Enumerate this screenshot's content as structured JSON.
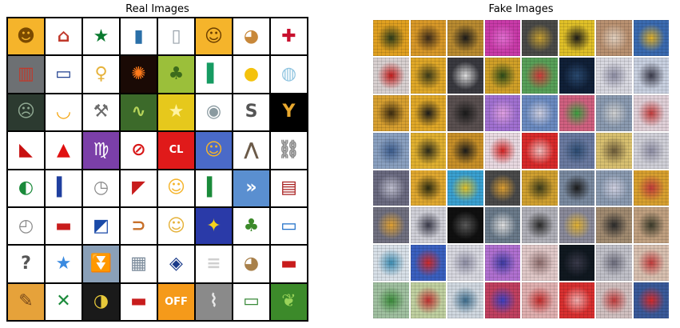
{
  "titles": {
    "left": "Real Images",
    "right": "Fake Images"
  },
  "real_tiles": [
    {
      "icon": "baby-face-icon",
      "bg": "#f5b42b",
      "fg": "#7a4a00",
      "glyph": "☻"
    },
    {
      "icon": "house-icon",
      "bg": "#ffffff",
      "fg": "#c0392b",
      "glyph": "⌂"
    },
    {
      "icon": "ghana-flag-icon",
      "bg": "#ffffff",
      "fg": "#0a7a2f",
      "glyph": "★"
    },
    {
      "icon": "thread-spool-icon",
      "bg": "#ffffff",
      "fg": "#2a6fa8",
      "glyph": "▮"
    },
    {
      "icon": "salt-shaker-icon",
      "bg": "#ffffff",
      "fg": "#9aa3ab",
      "glyph": "▯"
    },
    {
      "icon": "woman-face-icon",
      "bg": "#f5b42b",
      "fg": "#6b3f00",
      "glyph": "☺"
    },
    {
      "icon": "dog-face-icon",
      "bg": "#ffffff",
      "fg": "#c8883a",
      "glyph": "◕"
    },
    {
      "icon": "norway-flag-icon",
      "bg": "#ffffff",
      "fg": "#c8102e",
      "glyph": "✚"
    },
    {
      "icon": "barber-pole-icon",
      "bg": "#6d7073",
      "fg": "#c0392b",
      "glyph": "▥"
    },
    {
      "icon": "police-car-icon",
      "bg": "#ffffff",
      "fg": "#1f3f8f",
      "glyph": "▭"
    },
    {
      "icon": "woman-icon",
      "bg": "#ffffff",
      "fg": "#e6b23a",
      "glyph": "♀"
    },
    {
      "icon": "fireworks-icon",
      "bg": "#1a0a05",
      "fg": "#ff7a1a",
      "glyph": "✺"
    },
    {
      "icon": "palm-tree-icon",
      "bg": "#9bbf3a",
      "fg": "#3d6b1c",
      "glyph": "♣"
    },
    {
      "icon": "ireland-flag-icon",
      "bg": "#ffffff",
      "fg": "#169b62",
      "glyph": "▌"
    },
    {
      "icon": "full-moon-icon",
      "bg": "#ffffff",
      "fg": "#f4c20d",
      "glyph": "●"
    },
    {
      "icon": "snow-globe-icon",
      "bg": "#ffffff",
      "fg": "#8fc4e0",
      "glyph": "◍"
    },
    {
      "icon": "zombie-icon",
      "bg": "#2c3a30",
      "fg": "#8fa892",
      "glyph": "☹"
    },
    {
      "icon": "upside-down-face-icon",
      "bg": "#ffffff",
      "fg": "#f5a30a",
      "glyph": "◡"
    },
    {
      "icon": "hammer-wrench-icon",
      "bg": "#ffffff",
      "fg": "#6b6b6b",
      "glyph": "⚒"
    },
    {
      "icon": "dragon-icon",
      "bg": "#3c6a2a",
      "fg": "#b6d45a",
      "glyph": "∿"
    },
    {
      "icon": "shooting-star-icon",
      "bg": "#e6c81c",
      "fg": "#fff3a0",
      "glyph": "★"
    },
    {
      "icon": "alien-icon",
      "bg": "#ffffff",
      "fg": "#8a9aa0",
      "glyph": "◉"
    },
    {
      "icon": "dollar-sign-icon",
      "bg": "#ffffff",
      "fg": "#555555",
      "glyph": "S"
    },
    {
      "icon": "gymnast-icon",
      "bg": "#000000",
      "fg": "#e8a82e",
      "glyph": "Y"
    },
    {
      "icon": "high-heel-icon",
      "bg": "#ffffff",
      "fg": "#c81010",
      "glyph": "◣"
    },
    {
      "icon": "red-triangle-up-icon",
      "bg": "#ffffff",
      "fg": "#e01010",
      "glyph": "▲"
    },
    {
      "icon": "virgo-icon",
      "bg": "#7b3fa8",
      "fg": "#ffffff",
      "glyph": "♍"
    },
    {
      "icon": "prohibited-icon",
      "bg": "#ffffff",
      "fg": "#d81818",
      "glyph": "⊘"
    },
    {
      "icon": "cl-button-icon",
      "bg": "#e01a1a",
      "fg": "#ffffff",
      "glyph": "CL"
    },
    {
      "icon": "family-icon",
      "bg": "#4a6ac8",
      "fg": "#f5b42b",
      "glyph": "☺"
    },
    {
      "icon": "bat-icon",
      "bg": "#ffffff",
      "fg": "#6b5a48",
      "glyph": "⋀"
    },
    {
      "icon": "chains-icon",
      "bg": "#ffffff",
      "fg": "#8a8a8a",
      "glyph": "⛓"
    },
    {
      "icon": "comoros-flag-icon",
      "bg": "#ffffff",
      "fg": "#1a8a3a",
      "glyph": "◐"
    },
    {
      "icon": "france-flag-icon",
      "bg": "#ffffff",
      "fg": "#1f3f9f",
      "glyph": "▍"
    },
    {
      "icon": "stopwatch-icon",
      "bg": "#ffffff",
      "fg": "#8a8a8a",
      "glyph": "◷"
    },
    {
      "icon": "sint-maarten-flag-icon",
      "bg": "#ffffff",
      "fg": "#c81c1c",
      "glyph": "◤"
    },
    {
      "icon": "grinning-face-icon",
      "bg": "#ffffff",
      "fg": "#f5b42b",
      "glyph": "☺"
    },
    {
      "icon": "italy-flag-icon",
      "bg": "#ffffff",
      "fg": "#1a8a3a",
      "glyph": "▍"
    },
    {
      "icon": "fast-forward-button-icon",
      "bg": "#5a8fd0",
      "fg": "#ffffff",
      "glyph": "»"
    },
    {
      "icon": "oil-drum-icon",
      "bg": "#ffffff",
      "fg": "#a82020",
      "glyph": "▤"
    },
    {
      "icon": "clock-icon",
      "bg": "#ffffff",
      "fg": "#8a8a8a",
      "glyph": "◴"
    },
    {
      "icon": "liechtenstein-flag-icon",
      "bg": "#ffffff",
      "fg": "#c81c1c",
      "glyph": "▬"
    },
    {
      "icon": "namibia-flag-icon",
      "bg": "#ffffff",
      "fg": "#1a4aa8",
      "glyph": "◩"
    },
    {
      "icon": "hot-dog-icon",
      "bg": "#ffffff",
      "fg": "#c8702a",
      "glyph": "⊃"
    },
    {
      "icon": "person-turban-icon",
      "bg": "#ffffff",
      "fg": "#e6b23a",
      "glyph": "☺"
    },
    {
      "icon": "reunion-flag-icon",
      "bg": "#2a3aa8",
      "fg": "#f5d21a",
      "glyph": "✦"
    },
    {
      "icon": "broccoli-icon",
      "bg": "#ffffff",
      "fg": "#3c8a2a",
      "glyph": "♣"
    },
    {
      "icon": "trolleybus-icon",
      "bg": "#ffffff",
      "fg": "#1f6fc8",
      "glyph": "▭"
    },
    {
      "icon": "question-mark-button-icon",
      "bg": "#ffffff",
      "fg": "#555555",
      "glyph": "?"
    },
    {
      "icon": "somalia-flag-icon",
      "bg": "#ffffff",
      "fg": "#3a8ae0",
      "glyph": "★"
    },
    {
      "icon": "fast-down-button-icon",
      "bg": "#8aa0b8",
      "fg": "#ffffff",
      "glyph": "⏬"
    },
    {
      "icon": "office-building-icon",
      "bg": "#ffffff",
      "fg": "#7a8a9a",
      "glyph": "▦"
    },
    {
      "icon": "guam-flag-icon",
      "bg": "#ffffff",
      "fg": "#1a3a8a",
      "glyph": "◈"
    },
    {
      "icon": "scroll-icon",
      "bg": "#ffffff",
      "fg": "#cfcfcf",
      "glyph": "≡"
    },
    {
      "icon": "see-no-evil-monkey-icon",
      "bg": "#ffffff",
      "fg": "#a8804a",
      "glyph": "◕"
    },
    {
      "icon": "slovenia-flag-icon",
      "bg": "#ffffff",
      "fg": "#c81c1c",
      "glyph": "▬"
    },
    {
      "icon": "artist-palette-icon",
      "bg": "#e6a23a",
      "fg": "#7a4a1a",
      "glyph": "✎"
    },
    {
      "icon": "jamaica-flag-icon",
      "bg": "#ffffff",
      "fg": "#1a8a3a",
      "glyph": "✕"
    },
    {
      "icon": "crescent-moon-icon",
      "bg": "#1a1a1a",
      "fg": "#e6c83a",
      "glyph": "◑"
    },
    {
      "icon": "toolbox-icon",
      "bg": "#ffffff",
      "fg": "#c81c1c",
      "glyph": "▬"
    },
    {
      "icon": "off-button-icon",
      "bg": "#f59a1a",
      "fg": "#ffffff",
      "glyph": "OFF"
    },
    {
      "icon": "bone-icon",
      "bg": "#8a8a8a",
      "fg": "#e8e8e8",
      "glyph": "⌇"
    },
    {
      "icon": "tram-icon",
      "bg": "#ffffff",
      "fg": "#3a8a3a",
      "glyph": "▭"
    },
    {
      "icon": "leafy-green-icon",
      "bg": "#3c8a2a",
      "fg": "#9ad45a",
      "glyph": "❦"
    }
  ],
  "fake_tiles": [
    {
      "icon": "generated-blur-icon",
      "bg": "#e0a020",
      "fg": "#2a3a1a"
    },
    {
      "icon": "generated-blur-icon",
      "bg": "#d89828",
      "fg": "#3a2a1a"
    },
    {
      "icon": "generated-blur-icon",
      "bg": "#b88a30",
      "fg": "#1a1a1a"
    },
    {
      "icon": "generated-blur-icon",
      "bg": "#c83aa8",
      "fg": "#e070d0"
    },
    {
      "icon": "generated-blur-icon",
      "bg": "#4a4a48",
      "fg": "#c8a030"
    },
    {
      "icon": "generated-blur-icon",
      "bg": "#e0c028",
      "fg": "#1a1a1a"
    },
    {
      "icon": "generated-blur-icon",
      "bg": "#b89070",
      "fg": "#e0d0c0"
    },
    {
      "icon": "generated-blur-icon",
      "bg": "#3a6ab0",
      "fg": "#e0b028"
    },
    {
      "icon": "generated-blur-icon",
      "bg": "#d8d0d0",
      "fg": "#c01a1a"
    },
    {
      "icon": "generated-blur-icon",
      "bg": "#e0a828",
      "fg": "#3a3a1a"
    },
    {
      "icon": "generated-blur-icon",
      "bg": "#3a3a40",
      "fg": "#e0e0e0"
    },
    {
      "icon": "generated-blur-icon",
      "bg": "#d0a028",
      "fg": "#2a4a1a"
    },
    {
      "icon": "generated-blur-icon",
      "bg": "#58a058",
      "fg": "#d03a3a"
    },
    {
      "icon": "generated-blur-icon",
      "bg": "#102038",
      "fg": "#2a4a70"
    },
    {
      "icon": "generated-blur-icon",
      "bg": "#d8d8e0",
      "fg": "#8a8aa0"
    },
    {
      "icon": "generated-blur-icon",
      "bg": "#c8d0e0",
      "fg": "#3a3a4a"
    },
    {
      "icon": "generated-blur-icon",
      "bg": "#d8a030",
      "fg": "#3a2a10"
    },
    {
      "icon": "generated-blur-icon",
      "bg": "#e0a828",
      "fg": "#1a1a1a"
    },
    {
      "icon": "generated-blur-icon",
      "bg": "#5a5050",
      "fg": "#1a1a1a"
    },
    {
      "icon": "generated-blur-icon",
      "bg": "#a070d0",
      "fg": "#e0a0e0"
    },
    {
      "icon": "generated-blur-icon",
      "bg": "#6a8ac0",
      "fg": "#d0d0e0"
    },
    {
      "icon": "generated-blur-icon",
      "bg": "#d06080",
      "fg": "#3aa040"
    },
    {
      "icon": "generated-blur-icon",
      "bg": "#8a9ab0",
      "fg": "#d0d0d0"
    },
    {
      "icon": "generated-blur-icon",
      "bg": "#e0d0d8",
      "fg": "#c03a3a"
    },
    {
      "icon": "generated-blur-icon",
      "bg": "#8aa0c0",
      "fg": "#3a5a8a"
    },
    {
      "icon": "generated-blur-icon",
      "bg": "#e0b030",
      "fg": "#2a2a1a"
    },
    {
      "icon": "generated-blur-icon",
      "bg": "#c89028",
      "fg": "#1a1a1a"
    },
    {
      "icon": "generated-blur-icon",
      "bg": "#e8d8e0",
      "fg": "#d02020"
    },
    {
      "icon": "generated-blur-icon",
      "bg": "#d82a2a",
      "fg": "#f0c0c0"
    },
    {
      "icon": "generated-blur-icon",
      "bg": "#6a7aa0",
      "fg": "#2a4a70"
    },
    {
      "icon": "generated-blur-icon",
      "bg": "#d8c070",
      "fg": "#6a5a3a"
    },
    {
      "icon": "generated-blur-icon",
      "bg": "#d0d0d8",
      "fg": "#8a8aa0"
    },
    {
      "icon": "generated-blur-icon",
      "bg": "#6a6a80",
      "fg": "#c0c0d0"
    },
    {
      "icon": "generated-blur-icon",
      "bg": "#e0a830",
      "fg": "#2a2a10"
    },
    {
      "icon": "generated-blur-icon",
      "bg": "#3aa0d0",
      "fg": "#e0c028"
    },
    {
      "icon": "generated-blur-icon",
      "bg": "#4a4a4a",
      "fg": "#e0a030"
    },
    {
      "icon": "generated-blur-icon",
      "bg": "#d0a030",
      "fg": "#3a3a1a"
    },
    {
      "icon": "generated-blur-icon",
      "bg": "#7a8aa0",
      "fg": "#1a1a1a"
    },
    {
      "icon": "generated-blur-icon",
      "bg": "#8a9ab0",
      "fg": "#d0d0e0"
    },
    {
      "icon": "generated-blur-icon",
      "bg": "#d8a030",
      "fg": "#c03a3a"
    },
    {
      "icon": "generated-blur-icon",
      "bg": "#707080",
      "fg": "#e0a030"
    },
    {
      "icon": "generated-blur-icon",
      "bg": "#d0d0d8",
      "fg": "#3a3a4a"
    },
    {
      "icon": "generated-blur-icon",
      "bg": "#101010",
      "fg": "#5a5a5a"
    },
    {
      "icon": "generated-blur-icon",
      "bg": "#6a7a8a",
      "fg": "#e0e0e0"
    },
    {
      "icon": "generated-blur-icon",
      "bg": "#b0b0b8",
      "fg": "#2a2a2a"
    },
    {
      "icon": "generated-blur-icon",
      "bg": "#8a8a9a",
      "fg": "#e0b030"
    },
    {
      "icon": "generated-blur-icon",
      "bg": "#a08a70",
      "fg": "#2a2a2a"
    },
    {
      "icon": "generated-blur-icon",
      "bg": "#c0a080",
      "fg": "#3a3a2a"
    },
    {
      "icon": "generated-blur-icon",
      "bg": "#d8e0e8",
      "fg": "#3a8ab0"
    },
    {
      "icon": "generated-blur-icon",
      "bg": "#3a60c0",
      "fg": "#d02a2a"
    },
    {
      "icon": "generated-blur-icon",
      "bg": "#d8d8e0",
      "fg": "#8a8aa0"
    },
    {
      "icon": "generated-blur-icon",
      "bg": "#b070d0",
      "fg": "#3a3aa0"
    },
    {
      "icon": "generated-blur-icon",
      "bg": "#e0c8c8",
      "fg": "#8a6a6a"
    },
    {
      "icon": "generated-blur-icon",
      "bg": "#101820",
      "fg": "#3a3a4a"
    },
    {
      "icon": "generated-blur-icon",
      "bg": "#c0c0c8",
      "fg": "#6a6a7a"
    },
    {
      "icon": "generated-blur-icon",
      "bg": "#d8c0b0",
      "fg": "#c03a3a"
    },
    {
      "icon": "generated-blur-icon",
      "bg": "#a0c0a0",
      "fg": "#3a8a3a"
    },
    {
      "icon": "generated-blur-icon",
      "bg": "#c0d0a0",
      "fg": "#c03030"
    },
    {
      "icon": "generated-blur-icon",
      "bg": "#d0d8e0",
      "fg": "#3a6a8a"
    },
    {
      "icon": "generated-blur-icon",
      "bg": "#c04060",
      "fg": "#3a40c0"
    },
    {
      "icon": "generated-blur-icon",
      "bg": "#e0b0b0",
      "fg": "#c02a2a"
    },
    {
      "icon": "generated-blur-icon",
      "bg": "#d83030",
      "fg": "#f0b0b0"
    },
    {
      "icon": "generated-blur-icon",
      "bg": "#d0c0c0",
      "fg": "#c03a3a"
    },
    {
      "icon": "generated-blur-icon",
      "bg": "#3a5a9a",
      "fg": "#d82a2a"
    }
  ]
}
